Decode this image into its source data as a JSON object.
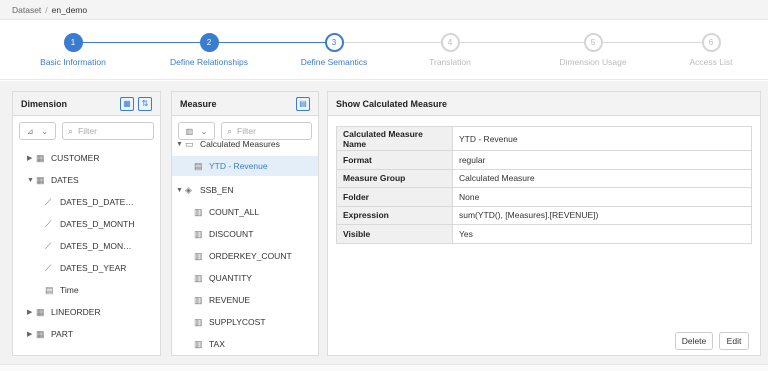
{
  "breadcrumb": {
    "root": "Dataset",
    "separator": "/",
    "current": "en_demo"
  },
  "steps": [
    {
      "number": "1",
      "label": "Basic Information",
      "state": "done"
    },
    {
      "number": "2",
      "label": "Define Relationships",
      "state": "done"
    },
    {
      "number": "3",
      "label": "Define Semantics",
      "state": "active"
    },
    {
      "number": "4",
      "label": "Translation",
      "state": "todo"
    },
    {
      "number": "5",
      "label": "Dimension Usage",
      "state": "todo"
    },
    {
      "number": "6",
      "label": "Access List",
      "state": "todo"
    }
  ],
  "colors": {
    "accent": "#3a7ccf",
    "inactive": "#d8d8d8",
    "selected_bg": "#e4eef9"
  },
  "dimension": {
    "title": "Dimension",
    "filter_placeholder": "Filter",
    "items": [
      {
        "label": "CUSTOMER",
        "icon": "table-icon",
        "expanded": false
      },
      {
        "label": "DATES",
        "icon": "table-icon",
        "expanded": true
      },
      {
        "label": "DATES_D_DATE…",
        "icon": "hierarchy-icon"
      },
      {
        "label": "DATES_D_MONTH",
        "icon": "hierarchy-icon"
      },
      {
        "label": "DATES_D_MON…",
        "icon": "hierarchy-icon"
      },
      {
        "label": "DATES_D_YEAR",
        "icon": "hierarchy-icon"
      },
      {
        "label": "Time",
        "icon": "calendar-icon"
      },
      {
        "label": "LINEORDER",
        "icon": "table-icon",
        "expanded": false
      },
      {
        "label": "PART",
        "icon": "table-icon",
        "expanded": false
      }
    ]
  },
  "measure": {
    "title": "Measure",
    "filter_placeholder": "Filter",
    "items": [
      {
        "label": "Calculated Measures",
        "icon": "folder-icon"
      },
      {
        "label": "YTD - Revenue",
        "icon": "calculated-measure-icon",
        "selected": true
      },
      {
        "label": "SSB_EN",
        "icon": "cube-icon",
        "expanded": true
      },
      {
        "label": "COUNT_ALL",
        "icon": "measure-icon"
      },
      {
        "label": "DISCOUNT",
        "icon": "measure-icon"
      },
      {
        "label": "ORDERKEY_COUNT",
        "icon": "measure-icon"
      },
      {
        "label": "QUANTITY",
        "icon": "measure-icon"
      },
      {
        "label": "REVENUE",
        "icon": "measure-icon"
      },
      {
        "label": "SUPPLYCOST",
        "icon": "measure-icon"
      },
      {
        "label": "TAX",
        "icon": "measure-icon"
      }
    ]
  },
  "detail": {
    "title": "Show Calculated Measure",
    "rows": [
      {
        "key": "Calculated Measure Name",
        "value": "YTD - Revenue"
      },
      {
        "key": "Format",
        "value": "regular"
      },
      {
        "key": "Measure Group",
        "value": "Calculated Measure"
      },
      {
        "key": "Folder",
        "value": "None"
      },
      {
        "key": "Expression",
        "value": "sum(YTD(), [Measures].[REVENUE])"
      },
      {
        "key": "Visible",
        "value": "Yes"
      }
    ],
    "delete_label": "Delete",
    "edit_label": "Edit"
  }
}
